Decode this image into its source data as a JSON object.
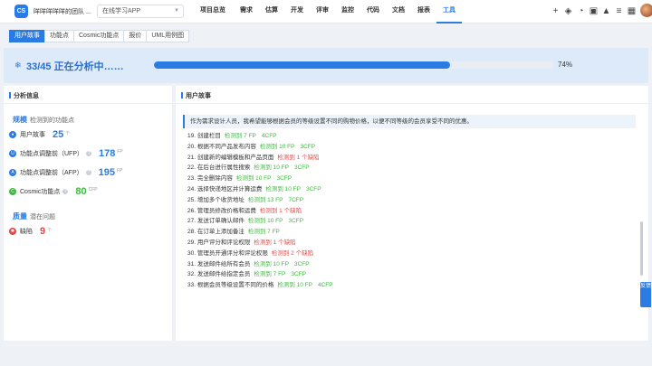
{
  "header": {
    "logo_text": "CS",
    "team_name": "咩咩咩咩咩的团队 ...",
    "app_select": "在线学习APP",
    "nav": [
      "项目总览",
      "需求",
      "估算",
      "开发",
      "评审",
      "监控",
      "代码",
      "文档",
      "报表",
      "工具"
    ],
    "active_nav": "工具",
    "icons": [
      "plus-icon",
      "layers-icon",
      "chart-pie-icon",
      "briefcase-icon",
      "bell-icon",
      "sliders-icon",
      "grid-icon"
    ]
  },
  "tabs": [
    "用户故事",
    "功能点",
    "Cosmic功能点",
    "报价",
    "UML用例图"
  ],
  "active_tab": "用户故事",
  "progress": {
    "status": "33/45 正在分析中……",
    "fraction": 0.74,
    "percent_label": "74%"
  },
  "analysis": {
    "title": "分析信息",
    "scale": {
      "label": "规模",
      "sub": "检测到的功能点",
      "metrics": [
        {
          "icon": "user-icon",
          "label": "用户故事",
          "value": "25",
          "unit": "个",
          "help": false,
          "color": "#2b7be4"
        },
        {
          "icon": "u-icon",
          "label": "功能点调整前（UFP）",
          "value": "178",
          "unit": "FP",
          "help": true,
          "color": "#2b7be4"
        },
        {
          "icon": "a-icon",
          "label": "功能点调整前（AFP）",
          "value": "195",
          "unit": "FP",
          "help": true,
          "color": "#2b7be4"
        },
        {
          "icon": "c-icon",
          "label": "Cosmic功能点",
          "value": "80",
          "unit": "CFP",
          "help": true,
          "color": "#3fb93f"
        }
      ]
    },
    "quality": {
      "label": "质量",
      "sub": "潜在问题",
      "metrics": [
        {
          "icon": "bug-icon",
          "label": "缺陷",
          "value": "9",
          "unit": "个",
          "help": false,
          "color": "#e24848"
        }
      ]
    }
  },
  "stories": {
    "title": "用户故事",
    "intro": "作为需求设计人员，我希望能够根据会员的等级设置不同的购物价格，以便不同等级的会员享受不同的优惠。",
    "items": [
      {
        "text": "19. 创建栏目",
        "detect": "检测到 7 FP",
        "cfp": "4CFP",
        "defect": false
      },
      {
        "text": "20. 根据不同产品发布内容",
        "detect": "检测到 10 FP",
        "cfp": "3CFP",
        "defect": false
      },
      {
        "text": "21. 创建新的编辑模板和产品页面",
        "detect": "检测到 1 个缺陷",
        "cfp": "",
        "defect": true
      },
      {
        "text": "22. 在后台进行属性搜索",
        "detect": "检测到 10 FP",
        "cfp": "3CFP",
        "defect": false
      },
      {
        "text": "23. 完全删除内容",
        "detect": "检测到 10 FP",
        "cfp": "3CFP",
        "defect": false
      },
      {
        "text": "24. 选择快递地区并计算运费",
        "detect": "检测到 10 FP",
        "cfp": "3CFP",
        "defect": false
      },
      {
        "text": "25. 增加多个收货地址",
        "detect": "检测到 13 FP",
        "cfp": "7CFP",
        "defect": false
      },
      {
        "text": "26. 管理员修改价格和运费",
        "detect": "检测到 1 个缺陷",
        "cfp": "",
        "defect": true
      },
      {
        "text": "27. 发送订单确认邮件",
        "detect": "检测到 10 FP",
        "cfp": "3CFP",
        "defect": false
      },
      {
        "text": "28. 在订单上添加备注",
        "detect": "检测到 7 FP",
        "cfp": "",
        "defect": false
      },
      {
        "text": "29. 用户评分和评论权限",
        "detect": "检测到 1 个缺陷",
        "cfp": "",
        "defect": true
      },
      {
        "text": "30. 管理员开通评分和评论权限",
        "detect": "检测到 2 个缺陷",
        "cfp": "",
        "defect": true
      },
      {
        "text": "31. 发送邮件给所有会员",
        "detect": "检测到 10 FP",
        "cfp": "3CFP",
        "defect": false
      },
      {
        "text": "32. 发送邮件给指定会员",
        "detect": "检测到 7 FP",
        "cfp": "3CFP",
        "defect": false
      },
      {
        "text": "33. 根据会员等级设置不同的价格",
        "detect": "检测到 10 FP",
        "cfp": "4CFP",
        "defect": false
      }
    ]
  },
  "feedback_label": "反馈"
}
